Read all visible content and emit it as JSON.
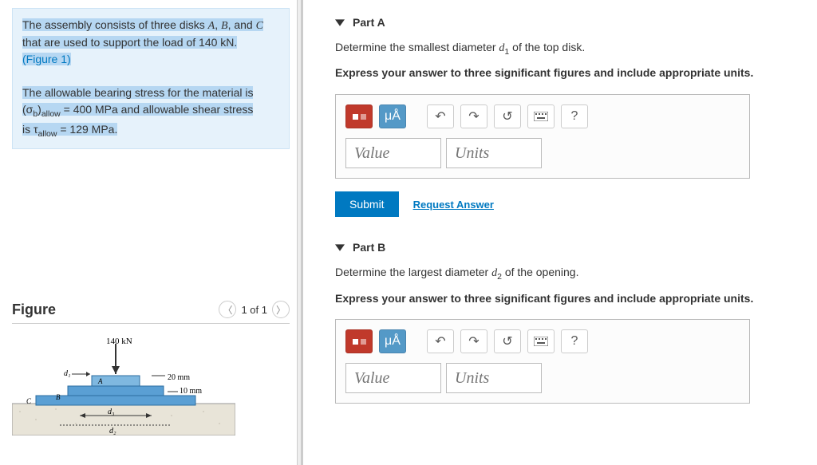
{
  "problem": {
    "line1a": "The assembly consists of three disks ",
    "line1b": ", and ",
    "line2": "that are used to support the load of 140 kN.",
    "figlink": "(Figure 1)",
    "line3": "The allowable bearing stress for the material is",
    "sigma_pre": "(σ",
    "sigma_sub": "b",
    "sigma_post": ")",
    "allow1": "allow",
    "eq1": " = 400 MPa",
    "and": " and allowable shear stress",
    "line5_pre": "is τ",
    "allow2": "allow",
    "eq2": " = 129 MPa.",
    "A": "A",
    "B": "B",
    "C": "C"
  },
  "figure": {
    "title": "Figure",
    "pager": "1 of 1",
    "load": "140 kN",
    "d1": "d₁",
    "d2": "d₂",
    "d3": "d₃",
    "t1": "20 mm",
    "t2": "10 mm",
    "lblA": "A",
    "lblB": "B",
    "lblC": "C"
  },
  "partA": {
    "header": "Part A",
    "prompt_pre": "Determine the smallest diameter ",
    "prompt_var": "d",
    "prompt_sub": "1",
    "prompt_post": " of the top disk.",
    "instruction": "Express your answer to three significant figures and include appropriate units.",
    "value_ph": "Value",
    "units_ph": "Units",
    "submit": "Submit",
    "request": "Request Answer",
    "muA": "μÅ"
  },
  "partB": {
    "header": "Part B",
    "prompt_pre": "Determine the largest diameter ",
    "prompt_var": "d",
    "prompt_sub": "2",
    "prompt_post": " of the opening.",
    "instruction": "Express your answer to three significant figures and include appropriate units.",
    "value_ph": "Value",
    "units_ph": "Units",
    "muA": "μÅ"
  },
  "icons": {
    "help": "?"
  }
}
